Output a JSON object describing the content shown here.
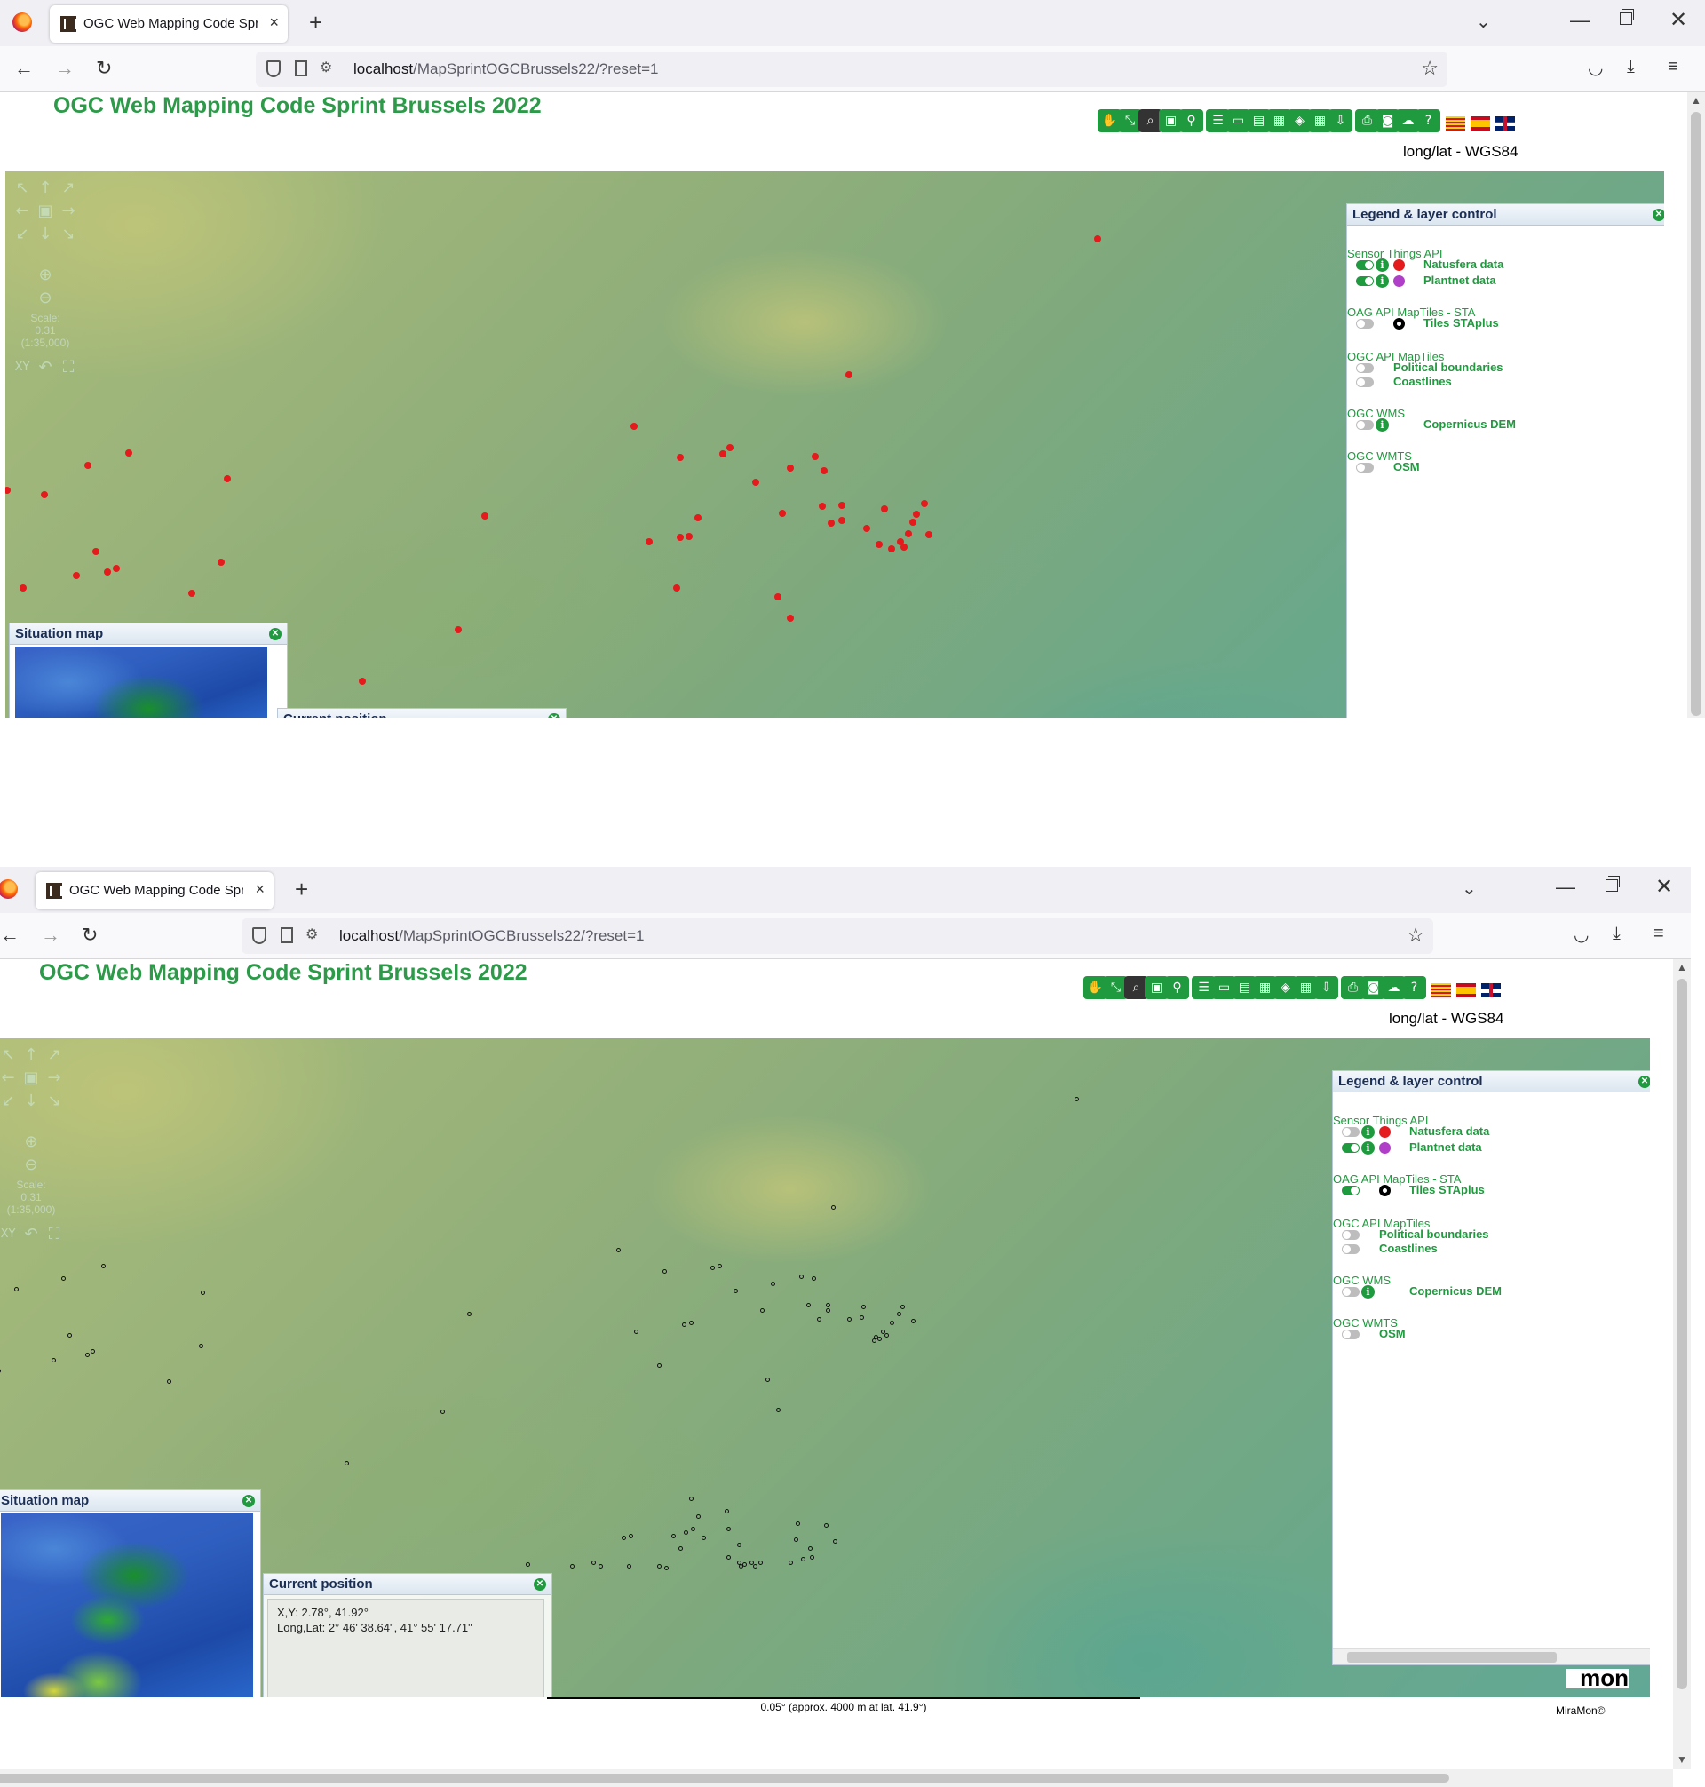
{
  "browser": {
    "tab_title": "OGC Web Mapping Code Sprint",
    "tab_close": "×",
    "new_tab": "+",
    "url_host": "localhost",
    "url_path": "/MapSprintOGCBrussels22/?reset=1"
  },
  "page": {
    "title": "OGC Web Mapping Code Sprint Brussels 2022",
    "crs_label": "long/lat - WGS84"
  },
  "toolbar_icons": [
    "pan-icon",
    "zoom-extent-icon",
    "zoom-window-icon",
    "image-icon",
    "query-icon",
    "settings-icon",
    "console-icon",
    "style-icon",
    "table-icon",
    "layers-icon",
    "calculator-icon",
    "download-icon",
    "print-icon",
    "screenshot-icon",
    "cloud-icon",
    "help-icon"
  ],
  "languages": [
    "Catalan",
    "Spanish",
    "English"
  ],
  "map_controls": {
    "scale_label": "Scale:",
    "scale_value": "0.31",
    "scale_ratio": "(1:35,000)",
    "xy_label": "XY"
  },
  "legend": {
    "title": "Legend & layer control",
    "groups": {
      "sta": "Sensor Things API",
      "oag_maptiles_sta": "OAG API MapTiles - STA",
      "ogc_maptiles": "OGC API MapTiles",
      "ogc_wms": "OGC WMS",
      "ogc_wmts": "OGC WMTS"
    },
    "layers": {
      "natusfera": "Natusfera data",
      "plantnet": "Plantnet data",
      "tiles_staplus": "Tiles STAplus",
      "political": "Political boundaries",
      "coastlines": "Coastlines",
      "copernicus": "Copernicus DEM",
      "osm": "OSM"
    },
    "colors": {
      "natusfera": "#e41a1c",
      "plantnet": "#b03ec8",
      "accent": "#1f9a3e"
    }
  },
  "situation_map": {
    "title": "Situation map"
  },
  "current_position": {
    "title": "Current position",
    "xy": "X,Y: 2.78°, 41.92°",
    "longlat": "Long,Lat: 2° 46' 38.64\", 41° 55' 17.71\""
  },
  "scale_bar": "0.05° (approx. 4000 m at lat. 41.9°)",
  "credit": "MiraMon©"
}
